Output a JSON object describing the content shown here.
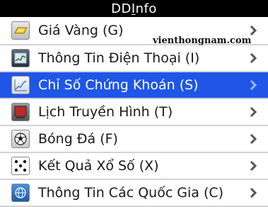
{
  "app": {
    "title_before": "DD",
    "title_underlined": "I",
    "title_after": "nfo"
  },
  "watermark": "vienthongnam.com",
  "menu": [
    {
      "label": "Giá Vàng (G)",
      "icon": "gold-bar-icon",
      "selected": false
    },
    {
      "label": "Thông Tin Điện Thoại (I)",
      "icon": "phone-chart-icon",
      "selected": false
    },
    {
      "label": "Chỉ Số Chứng Khoán (S)",
      "icon": "stock-chart-icon",
      "selected": true
    },
    {
      "label": "Lịch Truyền Hình (T)",
      "icon": "tv-icon",
      "selected": false
    },
    {
      "label": "Bóng Đá (F)",
      "icon": "soccer-ball-icon",
      "selected": false
    },
    {
      "label": "Kết Quả Xổ Số (X)",
      "icon": "dice-icon",
      "selected": false
    },
    {
      "label": "Thông Tin Các Quốc Gia (C)",
      "icon": "globe-icon",
      "selected": false
    }
  ],
  "colors": {
    "selected_background": "#1f56e8",
    "titlebar_background": "#000000",
    "separator": "#d3d3d3"
  }
}
